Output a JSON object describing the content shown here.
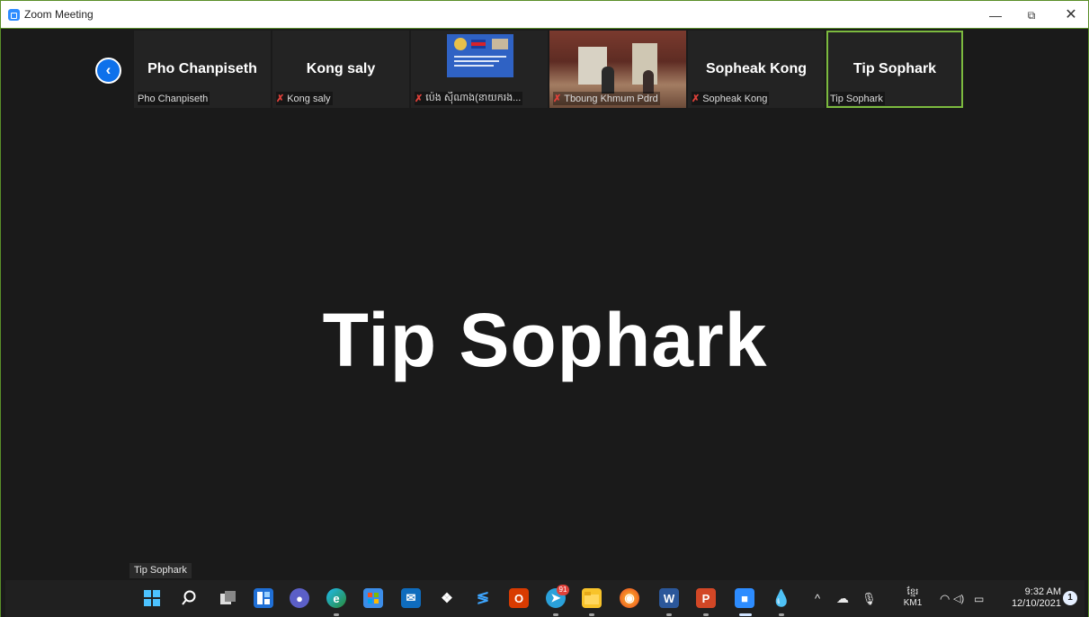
{
  "window": {
    "title": "Zoom Meeting",
    "controls": {
      "minimize": "—",
      "maximize": "⧉",
      "close": "✕"
    }
  },
  "participants_strip": {
    "back_icon": "chevron-left-icon",
    "tiles": [
      {
        "display_name": "Pho Chanpiseth",
        "label": "Pho Chanpiseth",
        "muted": false,
        "type": "name"
      },
      {
        "display_name": "Kong saly",
        "label": "Kong saly",
        "muted": true,
        "type": "name"
      },
      {
        "display_name": "",
        "label": "ប៉េង ស៊ីណាង(នាយករង...",
        "muted": true,
        "type": "screen"
      },
      {
        "display_name": "",
        "label": "Tboung Khmum Pdrd",
        "muted": true,
        "type": "video"
      },
      {
        "display_name": "Sopheak Kong",
        "label": "Sopheak Kong",
        "muted": true,
        "type": "name"
      },
      {
        "display_name": "Tip Sophark",
        "label": "Tip Sophark",
        "muted": false,
        "type": "name",
        "active": true
      }
    ]
  },
  "main_view": {
    "speaker_name": "Tip Sophark",
    "speaker_label": "Tip Sophark"
  },
  "taskbar": {
    "apps": [
      "windows-start-icon",
      "search-icon",
      "task-view-icon",
      "widgets-icon",
      "teams-chat-icon",
      "edge-icon",
      "store-icon",
      "mail-icon",
      "dropbox-icon",
      "visual-studio-code-icon",
      "office-icon",
      "telegram-icon",
      "file-explorer-icon",
      "firefox-icon",
      "word-icon",
      "powerpoint-icon",
      "zoom-icon",
      "ink-app-icon"
    ],
    "telegram_badge": "91",
    "tray": {
      "language_top": "ខ្មែរ",
      "language_bottom": "KM1",
      "time": "9:32 AM",
      "date": "12/10/2021",
      "notification_count": "1"
    }
  },
  "colors": {
    "accent_border": "#7cba3f",
    "zoom_blue": "#2d8cff",
    "muted_red": "#e0413a"
  }
}
